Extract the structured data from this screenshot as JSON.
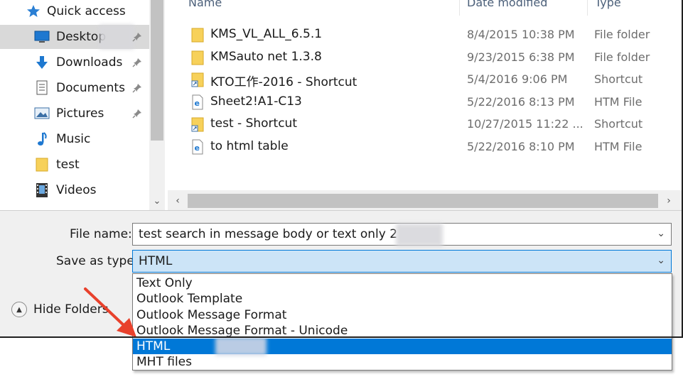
{
  "nav": {
    "items": [
      {
        "label": "Quick access",
        "icon": "star-icon",
        "pinned": false
      },
      {
        "label": "Desktop",
        "icon": "desktop-icon",
        "pinned": true,
        "selected": true
      },
      {
        "label": "Downloads",
        "icon": "download-icon",
        "pinned": true
      },
      {
        "label": "Documents",
        "icon": "documents-icon",
        "pinned": true
      },
      {
        "label": "Pictures",
        "icon": "pictures-icon",
        "pinned": true
      },
      {
        "label": "Music",
        "icon": "music-icon",
        "pinned": false
      },
      {
        "label": "test",
        "icon": "folder-icon",
        "pinned": false
      },
      {
        "label": "Videos",
        "icon": "videos-icon",
        "pinned": false
      }
    ]
  },
  "columns": {
    "name": "Name",
    "date": "Date modified",
    "type": "Type"
  },
  "files": [
    {
      "name": "KMS_VL_ALL_6.5.1",
      "date": "8/4/2015 10:38 PM",
      "type": "File folder",
      "icon": "folder-icon"
    },
    {
      "name": "KMSauto net 1.3.8",
      "date": "9/23/2015 6:38 PM",
      "type": "File folder",
      "icon": "folder-icon"
    },
    {
      "name": "KTO工作-2016 - Shortcut",
      "date": "5/4/2016 9:06 PM",
      "type": "Shortcut",
      "icon": "folder-shortcut-icon"
    },
    {
      "name": "Sheet2!A1-C13",
      "date": "5/22/2016 8:13 PM",
      "type": "HTM File",
      "icon": "html-file-icon"
    },
    {
      "name": "test - Shortcut",
      "date": "10/27/2015 11:22 ...",
      "type": "Shortcut",
      "icon": "folder-shortcut-icon"
    },
    {
      "name": "to html table",
      "date": "5/22/2016 8:10 PM",
      "type": "HTM File",
      "icon": "html-file-icon"
    }
  ],
  "form": {
    "file_name_label": "File name:",
    "file_name_value": "test search in message body or text only 2",
    "save_type_label": "Save as type:",
    "save_type_value": "HTML",
    "hide_folders": "Hide Folders"
  },
  "type_options": [
    {
      "label": "Text Only",
      "selected": false
    },
    {
      "label": "Outlook Template",
      "selected": false
    },
    {
      "label": "Outlook Message Format",
      "selected": false
    },
    {
      "label": "Outlook Message Format - Unicode",
      "selected": false
    },
    {
      "label": "HTML",
      "selected": true
    },
    {
      "label": "MHT files",
      "selected": false
    }
  ],
  "colors": {
    "selection": "#0078d7",
    "arrow": "#e8412c",
    "folder": "#f7d15a"
  }
}
